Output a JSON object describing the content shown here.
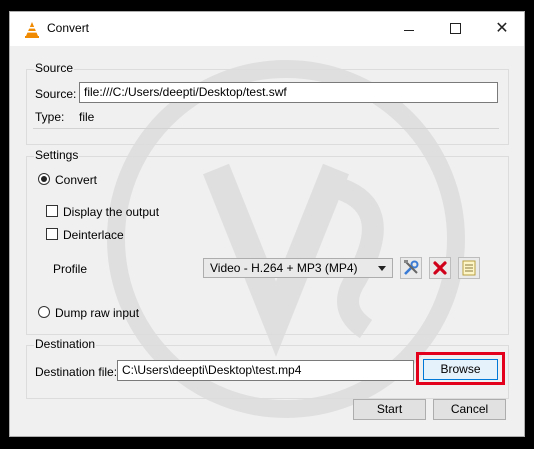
{
  "window": {
    "title": "Convert"
  },
  "source": {
    "group_label": "Source",
    "source_label": "Source:",
    "source_value": "file:///C:/Users/deepti/Desktop/test.swf",
    "type_label": "Type:",
    "type_value": "file"
  },
  "settings": {
    "group_label": "Settings",
    "convert_label": "Convert",
    "display_output_label": "Display the output",
    "deinterlace_label": "Deinterlace",
    "profile_label": "Profile",
    "profile_value": "Video - H.264 + MP3 (MP4)",
    "dump_raw_label": "Dump raw input"
  },
  "destination": {
    "group_label": "Destination",
    "file_label": "Destination file:",
    "file_value": "C:\\Users\\deepti\\Desktop\\test.mp4",
    "browse_label": "Browse"
  },
  "footer": {
    "start_label": "Start",
    "cancel_label": "Cancel"
  },
  "icons": {
    "app": "vlc-cone-icon",
    "edit_profile": "tools-icon",
    "delete_profile": "red-x-icon",
    "new_profile": "list-document-icon"
  },
  "colors": {
    "highlight": "#e3001b",
    "accent": "#0078d7"
  }
}
